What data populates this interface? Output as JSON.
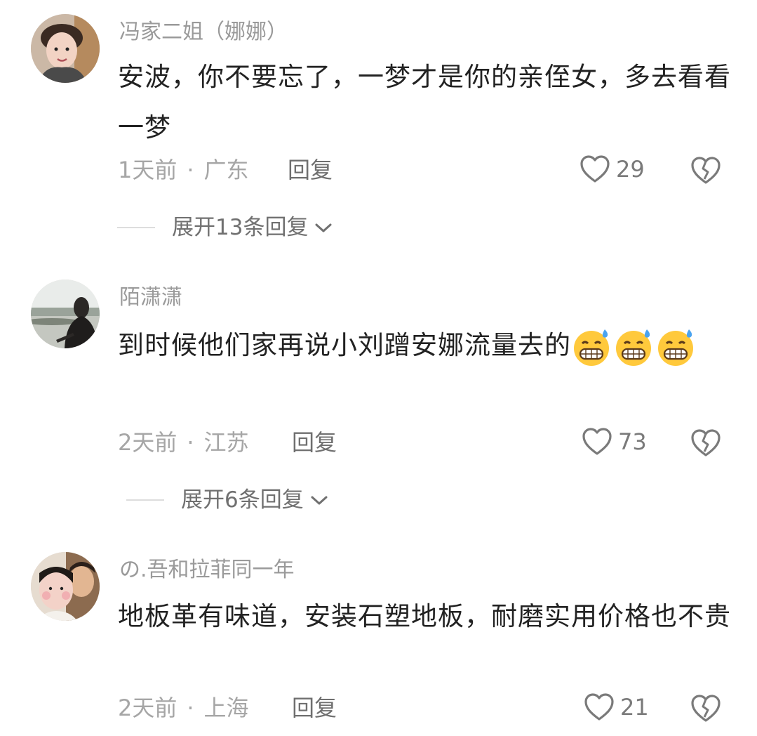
{
  "comments": [
    {
      "username": "冯家二姐（娜娜）",
      "text": "安波，你不要忘了，一梦才是你的亲侄女，多去看看一梦",
      "time": "1天前",
      "location": "广东",
      "reply_label": "回复",
      "likes": "29",
      "expand_label": "展开13条回复",
      "avatar_icon": "woman-portrait-avatar"
    },
    {
      "username": "陌潇潇",
      "text": "到时候他们家再说小刘蹭安娜流量去的",
      "emojis": [
        "grimace-sweat-emoji",
        "grimace-sweat-emoji",
        "grimace-sweat-emoji"
      ],
      "time": "2天前",
      "location": "江苏",
      "reply_label": "回复",
      "likes": "73",
      "expand_label": "展开6条回复",
      "avatar_icon": "silhouette-lake-avatar"
    },
    {
      "username": "の.吾和拉菲同一年",
      "text": "地板革有味道，安装石塑地板，耐磨实用价格也不贵",
      "time": "2天前",
      "location": "上海",
      "reply_label": "回复",
      "likes": "21",
      "avatar_icon": "two-people-avatar"
    }
  ],
  "colors": {
    "text": "#222222",
    "meta": "#a6a6a6",
    "username": "#9a9a9a"
  }
}
